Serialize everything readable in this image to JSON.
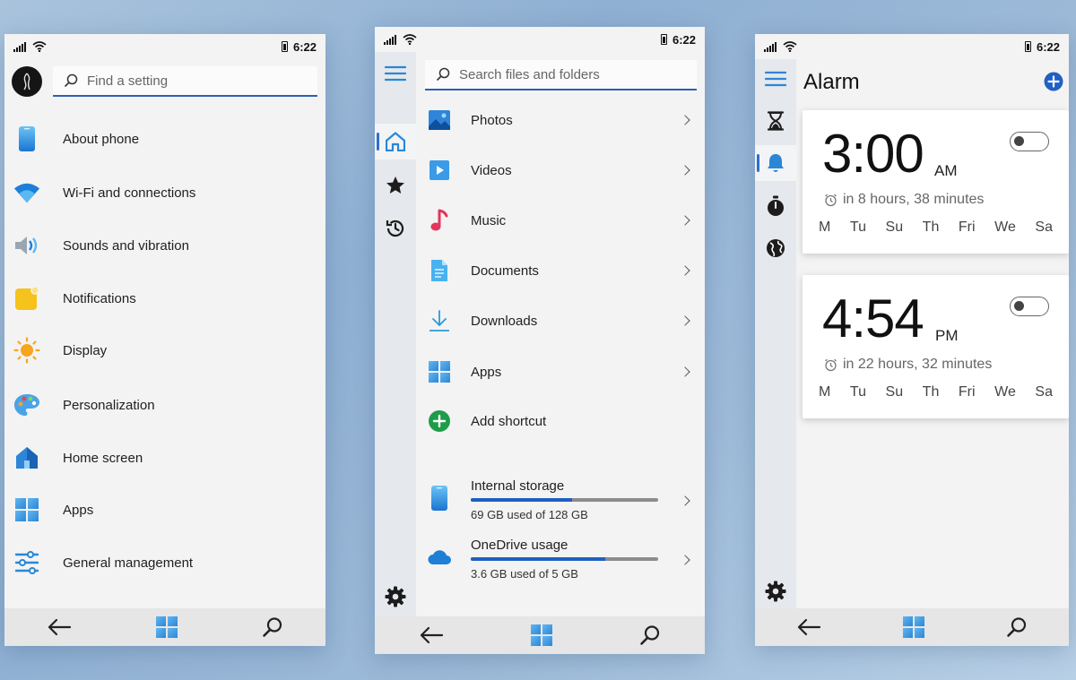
{
  "status": {
    "time": "6:22"
  },
  "settings": {
    "search_placeholder": "Find a setting",
    "items": [
      {
        "label": "About phone",
        "icon": "phone-icon"
      },
      {
        "label": "Wi-Fi and connections",
        "icon": "wifi-icon"
      },
      {
        "label": "Sounds and vibration",
        "icon": "speaker-icon"
      },
      {
        "label": "Notifications",
        "icon": "notification-icon"
      },
      {
        "label": "Display",
        "icon": "sun-icon"
      },
      {
        "label": "Personalization",
        "icon": "palette-icon"
      },
      {
        "label": "Home screen",
        "icon": "home-icon"
      },
      {
        "label": "Apps",
        "icon": "apps-icon"
      },
      {
        "label": "General management",
        "icon": "sliders-icon"
      }
    ]
  },
  "files": {
    "search_placeholder": "Search files and folders",
    "items": [
      {
        "label": "Photos",
        "icon": "photos-icon"
      },
      {
        "label": "Videos",
        "icon": "video-icon"
      },
      {
        "label": "Music",
        "icon": "music-icon"
      },
      {
        "label": "Documents",
        "icon": "document-icon"
      },
      {
        "label": "Downloads",
        "icon": "download-icon"
      },
      {
        "label": "Apps",
        "icon": "apps-icon"
      },
      {
        "label": "Add shortcut",
        "icon": "add-icon"
      }
    ],
    "storage": [
      {
        "name": "Internal storage",
        "used_text": "69 GB used of 128 GB",
        "fraction": 0.539,
        "icon": "phone-icon"
      },
      {
        "name": "OneDrive usage",
        "used_text": "3.6 GB used of 5 GB",
        "fraction": 0.72,
        "icon": "cloud-icon"
      }
    ]
  },
  "clock": {
    "title": "Alarm",
    "alarms": [
      {
        "time": "3:00",
        "ampm": "AM",
        "relative": "in 8 hours, 38 minutes",
        "days": [
          "M",
          "Tu",
          "Su",
          "Th",
          "Fri",
          "We",
          "Sa"
        ],
        "enabled": false
      },
      {
        "time": "4:54",
        "ampm": "PM",
        "relative": "in 22 hours, 32 minutes",
        "days": [
          "M",
          "Tu",
          "Su",
          "Th",
          "Fri",
          "We",
          "Sa"
        ],
        "enabled": false
      }
    ]
  },
  "colors": {
    "accent": "#2d5fb4",
    "progress": "#1f5fc2"
  }
}
